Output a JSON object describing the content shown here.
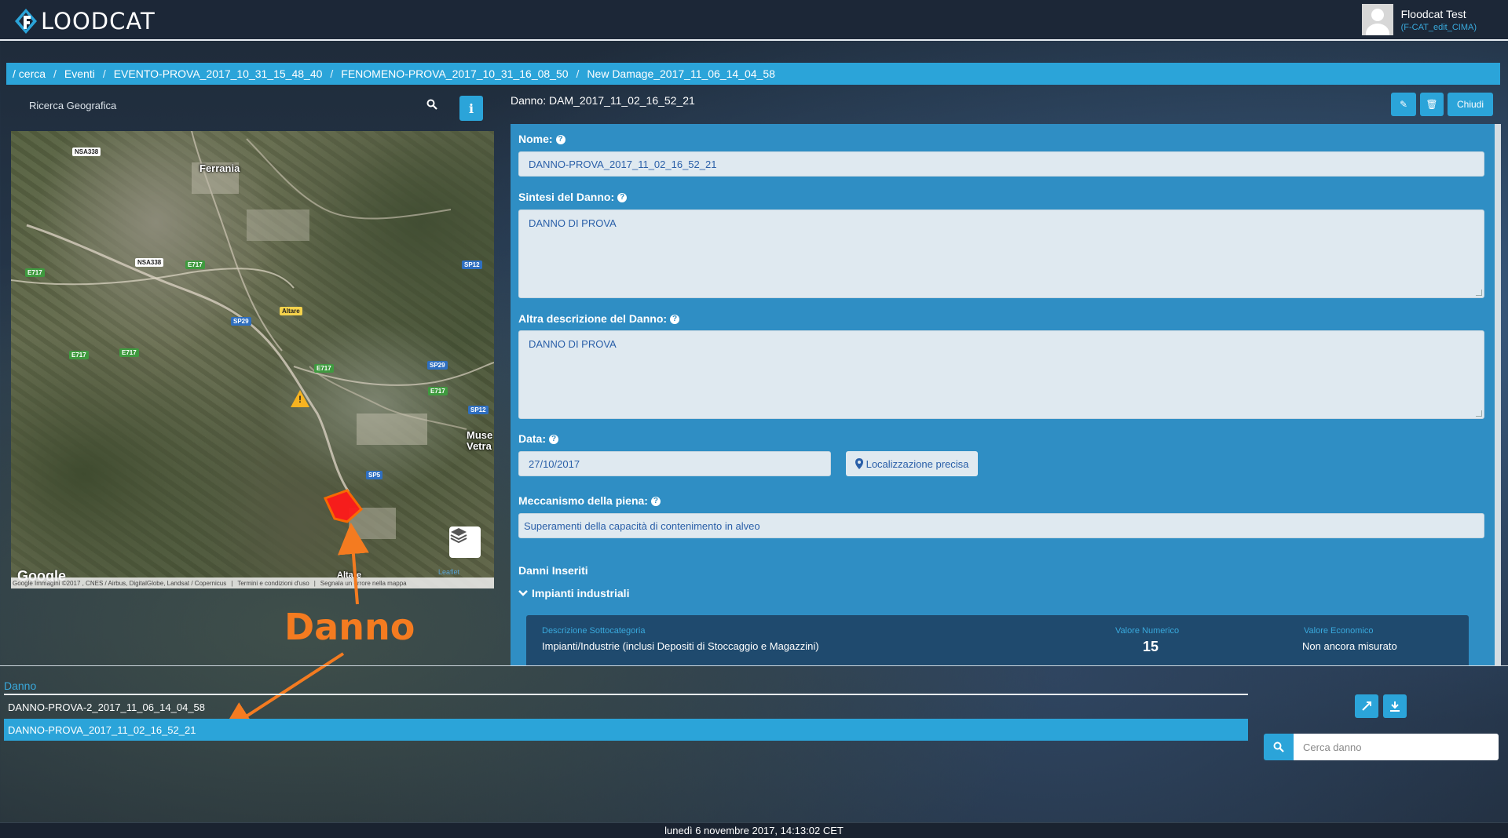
{
  "app": {
    "logo_text": "LOODCAT"
  },
  "user": {
    "name": "Floodcat Test",
    "role": "(F-CAT_edit_CIMA)"
  },
  "breadcrumb": [
    "/ cerca",
    "Eventi",
    "EVENTO-PROVA_2017_10_31_15_48_40",
    "FENOMENO-PROVA_2017_10_31_16_08_50",
    "New Damage_2017_11_06_14_04_58"
  ],
  "geo_search": {
    "label": "Ricerca Geografica"
  },
  "map": {
    "towns": [
      "Ferrania",
      "Muse",
      "Vetra",
      "Altare"
    ],
    "road_labels": [
      "NSA338",
      "NSA338",
      "E717",
      "E717",
      "E717",
      "E717",
      "E717",
      "E717",
      "SP29",
      "SP29",
      "SP12",
      "SP12",
      "SP5",
      "Altare"
    ],
    "google_logo": "Google",
    "attribution": [
      "Google Immagini ©2017 , CNES / Airbus, DigitalGlobe, Landsat / Copernicus",
      "Termini e condizioni d'uso",
      "Segnala un errore nella mappa"
    ],
    "leaflet": "Leaflet",
    "damage_color": "#ff1a1a"
  },
  "annotation": {
    "label": "Danno",
    "color": "#f47b20"
  },
  "damage_panel": {
    "title": "Danno: DAM_2017_11_02_16_52_21",
    "buttons": {
      "edit": "✎",
      "delete": "🗑",
      "close": "Chiudi"
    },
    "fields": {
      "name": {
        "label": "Nome:",
        "value": "DANNO-PROVA_2017_11_02_16_52_21"
      },
      "summary": {
        "label": "Sintesi del Danno:",
        "value": "DANNO DI PROVA"
      },
      "other_desc": {
        "label": "Altra descrizione del Danno:",
        "value": "DANNO DI PROVA"
      },
      "date": {
        "label": "Data:",
        "value": "27/10/2017"
      },
      "precise_location": "Localizzazione precisa",
      "mechanism": {
        "label": "Meccanismo della piena:",
        "value": "Superamenti della capacità di contenimento in alveo"
      }
    },
    "inserted_title": "Danni Inseriti",
    "category": {
      "name": "Impianti industriali",
      "headers": [
        "Descrizione Sottocategoria",
        "Valore Numerico",
        "Valore Economico"
      ],
      "row": [
        "Impianti/Industrie (inclusi Depositi di Stoccaggio e Magazzini)",
        "15",
        "Non ancora misurato"
      ]
    }
  },
  "damage_list": {
    "header": "Danno",
    "rows": [
      {
        "label": "DANNO-PROVA-2_2017_11_06_14_04_58",
        "selected": false
      },
      {
        "label": "DANNO-PROVA_2017_11_02_16_52_21",
        "selected": true
      }
    ],
    "search_placeholder": "Cerca danno"
  },
  "footer": {
    "datetime": "lunedì 6 novembre 2017, 14:13:02 CET"
  },
  "colors": {
    "accent": "#2ba4d9",
    "header_bg": "#1c2737",
    "panel_bg": "#2f8ec4"
  }
}
